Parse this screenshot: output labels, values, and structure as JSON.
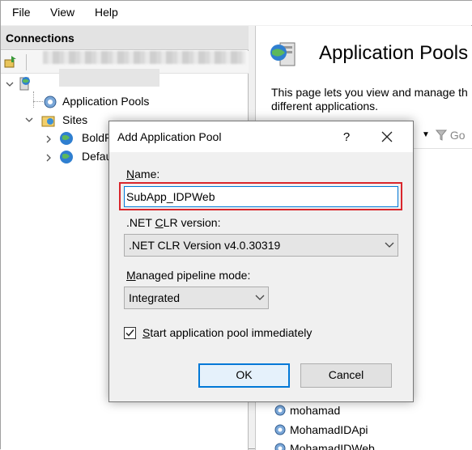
{
  "menu": {
    "file": "File",
    "view": "View",
    "help": "Help"
  },
  "connections": {
    "title": "Connections",
    "tree": {
      "app_pools": "Application Pools",
      "sites": "Sites",
      "site_1": "BoldR",
      "site_2": "Defau"
    }
  },
  "content": {
    "title": "Application Pools",
    "desc_line1": "This page lets you view and manage th",
    "desc_line2": "different applications.",
    "filter_go": "Go",
    "pools": [
      "mohamad",
      "MohamadIDApi",
      "MohamadIDWeb"
    ]
  },
  "dialog": {
    "title": "Add Application Pool",
    "help": "?",
    "name_label_ul": "N",
    "name_label_rest": "ame:",
    "name_value": "SubApp_IDPWeb",
    "clr_label_pre": ".NET ",
    "clr_label_ul": "C",
    "clr_label_rest": "LR version:",
    "clr_value": ".NET CLR Version v4.0.30319",
    "mode_label_ul": "M",
    "mode_label_rest": "anaged pipeline mode:",
    "mode_value": "Integrated",
    "start_label_ul": "S",
    "start_label_rest": "tart application pool immediately",
    "start_checked": true,
    "ok": "OK",
    "cancel": "Cancel"
  },
  "colors": {
    "highlight": "#d9262c",
    "focus": "#0078d7"
  }
}
